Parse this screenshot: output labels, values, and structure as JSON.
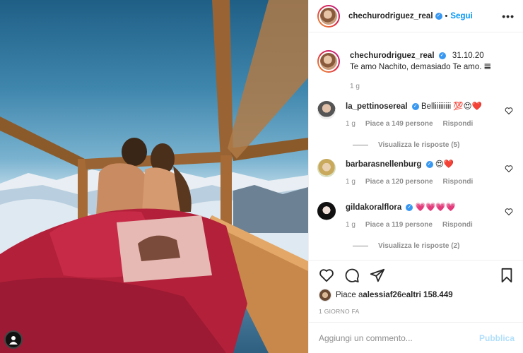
{
  "post": {
    "username": "chechurodriguez_real",
    "follow_label": "Segui",
    "more_label": "•••",
    "verified_mark": "✓"
  },
  "caption": {
    "username": "chechurodriguez_real",
    "date": "31.10.20",
    "text": "Te amo Nachito, demasiado Te amo. 𝌆",
    "time": "1 g"
  },
  "comments": [
    {
      "username": "la_pettinosereal",
      "text": "Belliiiiiiiii 💯😍❤️",
      "time": "1 g",
      "likes": "Piace a 149 persone",
      "reply": "Rispondi",
      "view_replies": "Visualizza le risposte (5)"
    },
    {
      "username": "barbarasnellenburg",
      "text": "😍❤️",
      "time": "1 g",
      "likes": "Piace a 120 persone",
      "reply": "Rispondi",
      "view_replies": ""
    },
    {
      "username": "gildakoralflora",
      "text": "💗💗💗💗",
      "time": "1 g",
      "likes": "Piace a 119 persone",
      "reply": "Rispondi",
      "view_replies": "Visualizza le risposte (2)"
    }
  ],
  "likes_line": {
    "prefix": "Piace a ",
    "user": "alessiaf26",
    "middle": " e ",
    "others": "altri 158.449"
  },
  "timestamp": "1 GIORNO FA",
  "comment_box": {
    "placeholder": "Aggiungi un commento...",
    "publish_label": "Pubblica"
  },
  "colors": {
    "link_blue": "#0095f6",
    "verified_blue": "#3897f0",
    "muted_gray": "#8e8e8e",
    "publish_disabled": "#b2dffc"
  },
  "icons": [
    "heart-icon",
    "comment-icon",
    "share-icon",
    "bookmark-icon",
    "verified-icon",
    "more-icon"
  ]
}
